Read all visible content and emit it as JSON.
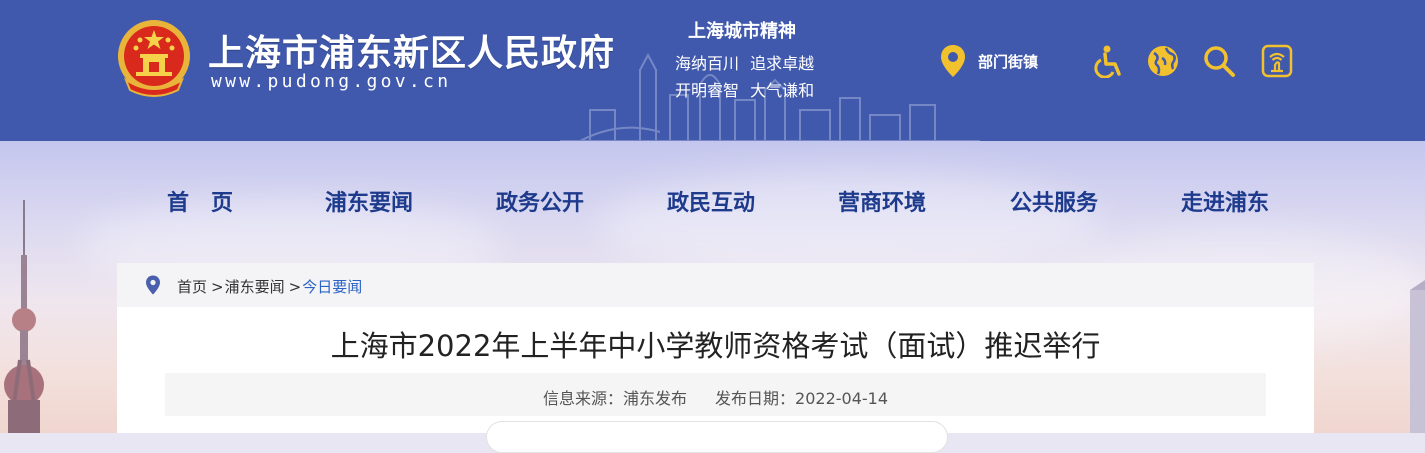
{
  "header": {
    "site_title": "上海市浦东新区人民政府",
    "site_url": "www.pudong.gov.cn",
    "spirit": {
      "title": "上海城市精神",
      "line1": "海纳百川  追求卓越",
      "line2": "开明睿智  大气谦和"
    },
    "dept_link": {
      "label": "部门街镇",
      "icon": "location-pin-icon"
    },
    "icons": [
      "accessibility-icon",
      "globe-icon",
      "search-icon",
      "elder-mode-icon"
    ],
    "colors": {
      "header_bg": "#4059ad",
      "icon_yellow": "#f2c12e"
    }
  },
  "nav": {
    "items": [
      "首　页",
      "浦东要闻",
      "政务公开",
      "政民互动",
      "营商环境",
      "公共服务",
      "走进浦东"
    ],
    "color": "#1d3a8c"
  },
  "breadcrumb": {
    "home": "首页",
    "level1": "浦东要闻",
    "current": "今日要闻",
    "separator": ">"
  },
  "article": {
    "title": "上海市2022年上半年中小学教师资格考试（面试）推迟举行",
    "source_label": "信息来源：",
    "source": "浦东发布",
    "date_label": "发布日期：",
    "date": "2022-04-14"
  }
}
